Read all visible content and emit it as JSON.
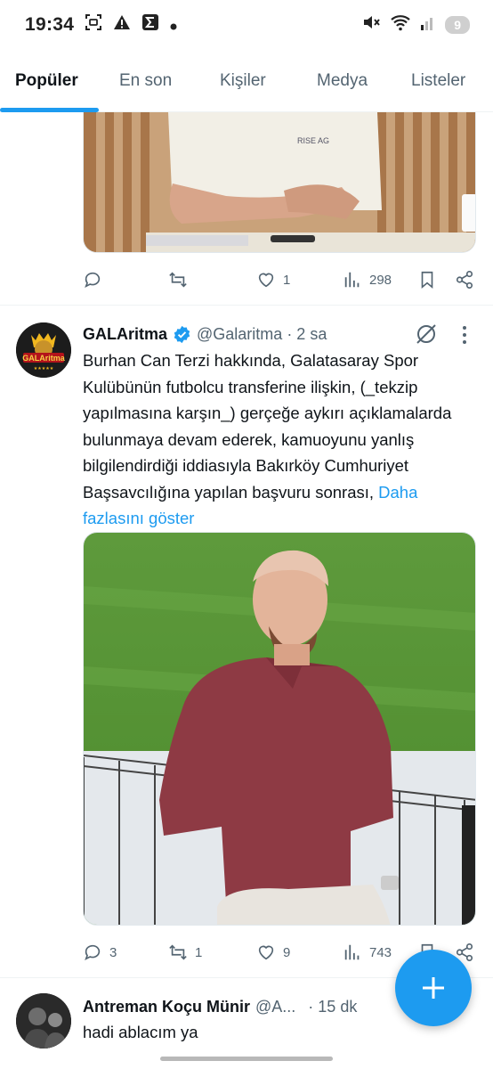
{
  "status_bar": {
    "time": "19:34",
    "battery": "9",
    "icons_left": [
      "screenshot-icon",
      "warning-icon",
      "sigma-icon",
      "dot-icon"
    ],
    "icons_right": [
      "mute-icon",
      "wifi-icon",
      "signal-icon"
    ]
  },
  "tabs": [
    {
      "label": "Popüler",
      "active": true
    },
    {
      "label": "En son",
      "active": false
    },
    {
      "label": "Kişiler",
      "active": false
    },
    {
      "label": "Medya",
      "active": false
    },
    {
      "label": "Listeler",
      "active": false
    }
  ],
  "tweet1": {
    "actions": {
      "reply": "",
      "retweet": "",
      "like": "1",
      "views": "298"
    }
  },
  "tweet2": {
    "name": "GALAritma",
    "handle": "@Galaritma",
    "time": "· 2 sa",
    "text": "Burhan Can Terzi hakkında, Galatasaray Spor Kulübünün futbolcu transferine ilişkin, (_tekzip yapılmasına karşın_) gerçeğe aykırı açıklamalarda bulunmaya devam ederek, kamuoyunu yanlış bilgilendirdiği iddiasıyla Bakırköy Cumhuriyet Başsavcılığına yapılan başvuru sonrası,",
    "show_more": "Daha fazlasını göster",
    "avatar_text": "GALAritma",
    "actions": {
      "reply": "3",
      "retweet": "1",
      "like": "9",
      "views": "743"
    }
  },
  "tweet3": {
    "name": "Antreman Koçu Münir",
    "handle": "@A...",
    "time": "· 15 dk",
    "text": "hadi ablacım ya"
  },
  "colors": {
    "accent": "#1d9bf0",
    "text": "#0f1419",
    "muted": "#536471",
    "verified": "#1d9bf0"
  }
}
